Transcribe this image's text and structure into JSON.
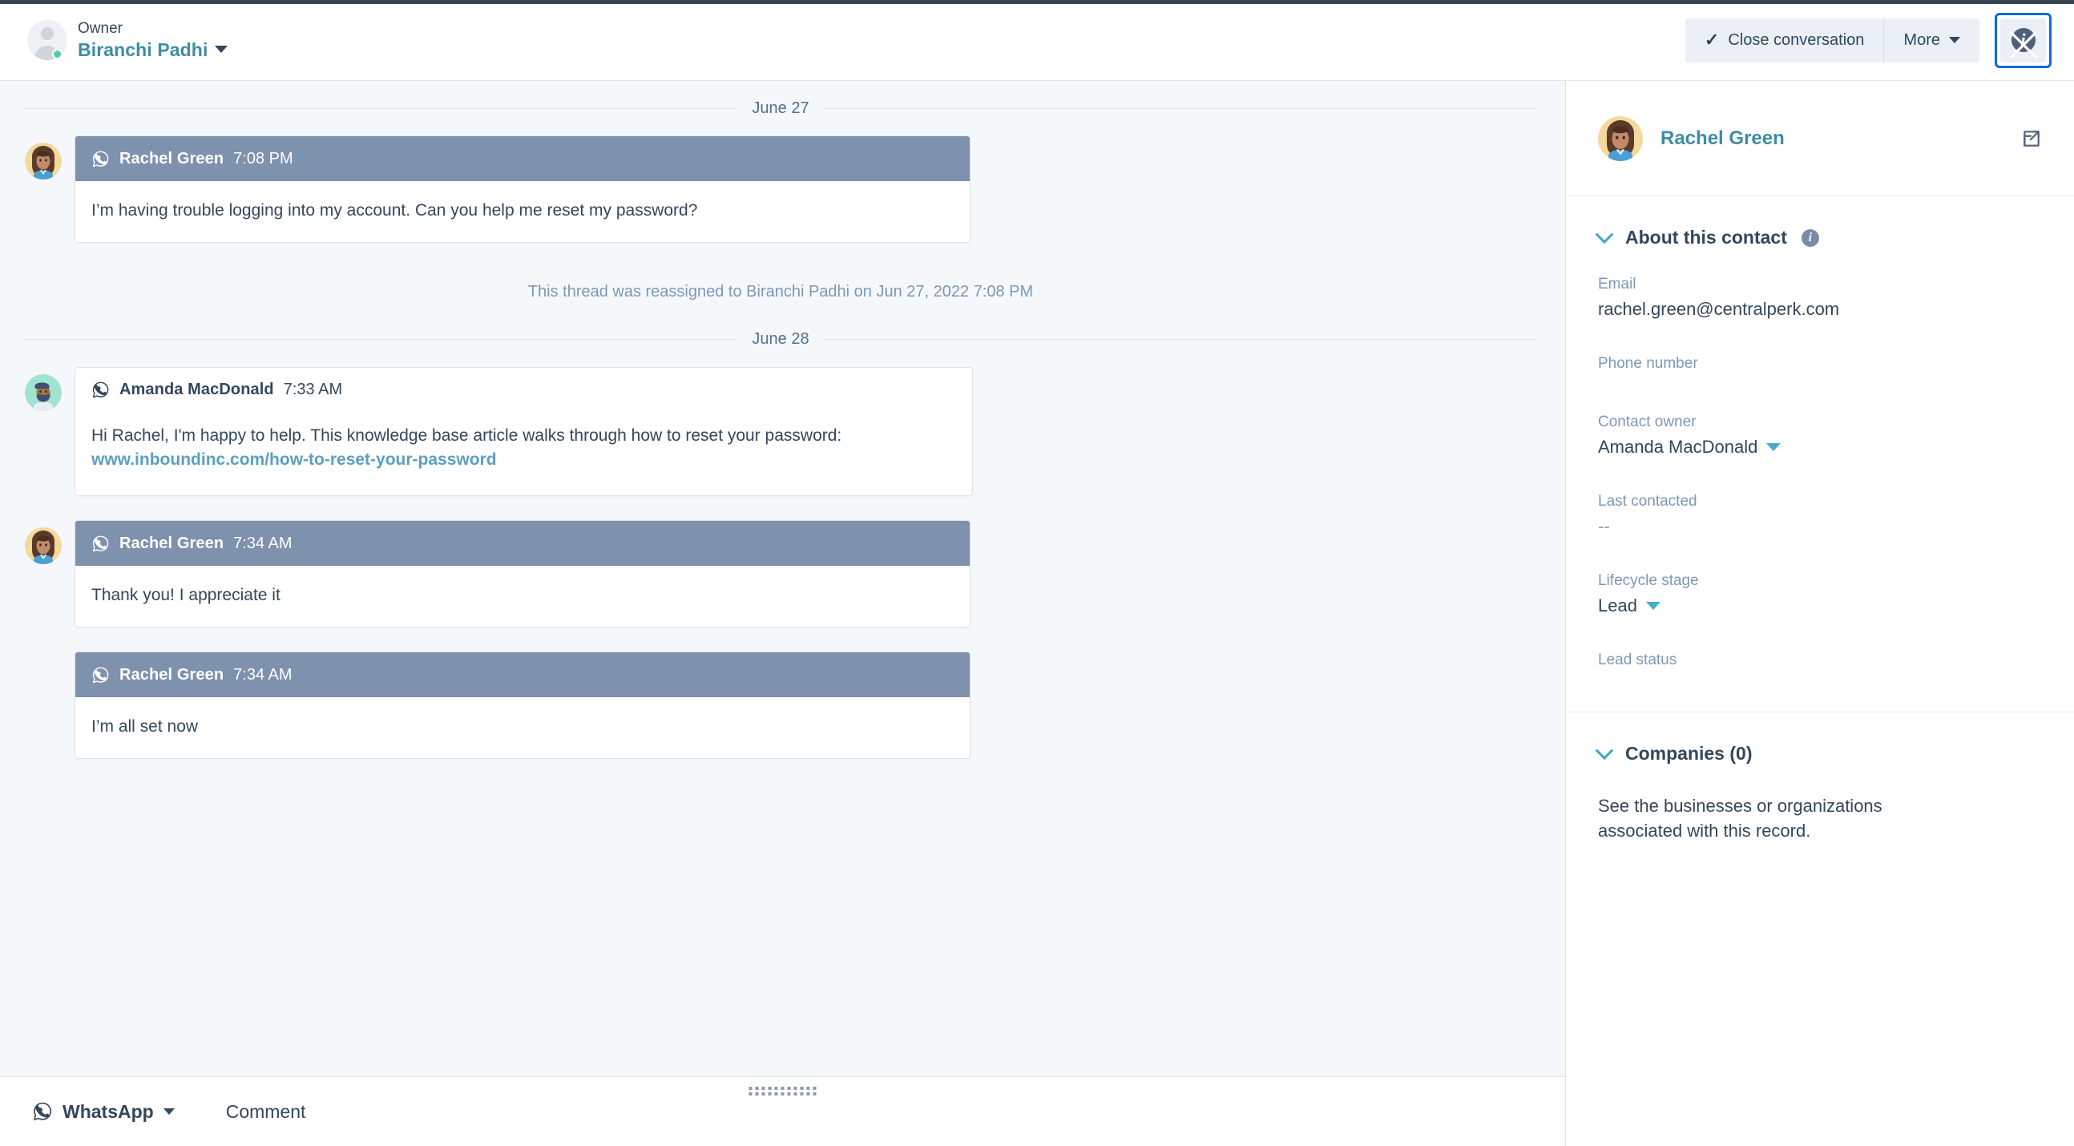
{
  "topbar": {
    "owner_label": "Owner",
    "owner_name": "Biranchi Padhi",
    "close_conversation_label": "Close conversation",
    "more_label": "More",
    "info_icon": "info-circle-icon"
  },
  "thread": {
    "dividers": {
      "day1": "June 27",
      "day2": "June 28"
    },
    "system_note": "This thread was reassigned to Biranchi Padhi on Jun 27, 2022 7:08 PM",
    "messages": [
      {
        "sender": "Rachel Green",
        "time": "7:08 PM",
        "channel_icon": "whatsapp-icon",
        "text": "I’m having trouble logging into my account. Can you help me reset my password?"
      },
      {
        "sender": "Amanda MacDonald",
        "time": "7:33 AM",
        "channel_icon": "whatsapp-icon",
        "text_before_link": "Hi Rachel, I'm happy to help. This knowledge base article walks through how to reset your password: ",
        "link_text": "www.inboundinc.com/how-to-reset-your-password"
      },
      {
        "sender": "Rachel Green",
        "time": "7:34 AM",
        "channel_icon": "whatsapp-icon",
        "text": "Thank you! I appreciate it"
      },
      {
        "sender": "Rachel Green",
        "time": "7:34 AM",
        "channel_icon": "whatsapp-icon",
        "text": "I’m all set now"
      }
    ]
  },
  "compose": {
    "channel_label": "WhatsApp",
    "comment_label": "Comment",
    "channel_icon": "whatsapp-icon",
    "drag_handle": "resize-handle"
  },
  "sidebar": {
    "contact_name": "Rachel Green",
    "open_record_icon": "external-link-icon",
    "about_section": {
      "title": "About this contact",
      "info_icon": "info-circle-icon",
      "properties": [
        {
          "label": "Email",
          "value": "rachel.green@centralperk.com",
          "has_dropdown": false
        },
        {
          "label": "Phone number",
          "value": "",
          "has_dropdown": false
        },
        {
          "label": "Contact owner",
          "value": "Amanda MacDonald",
          "has_dropdown": true
        },
        {
          "label": "Last contacted",
          "value": "--",
          "has_dropdown": false
        },
        {
          "label": "Lifecycle stage",
          "value": "Lead",
          "has_dropdown": true
        },
        {
          "label": "Lead status",
          "value": "",
          "has_dropdown": false
        }
      ]
    },
    "companies_section": {
      "title": "Companies (0)",
      "description": "See the businesses or organizations associated with this record."
    }
  },
  "colors": {
    "bubble_header": "#7e91ad",
    "accent_teal": "#3d8da3",
    "link_teal": "#5b9fbf",
    "text_primary": "#33475b",
    "text_muted": "#7c98b6",
    "focus_blue": "#0e6ade",
    "presence_green": "#4ecfa0",
    "thread_bg": "#f5f8fa"
  }
}
